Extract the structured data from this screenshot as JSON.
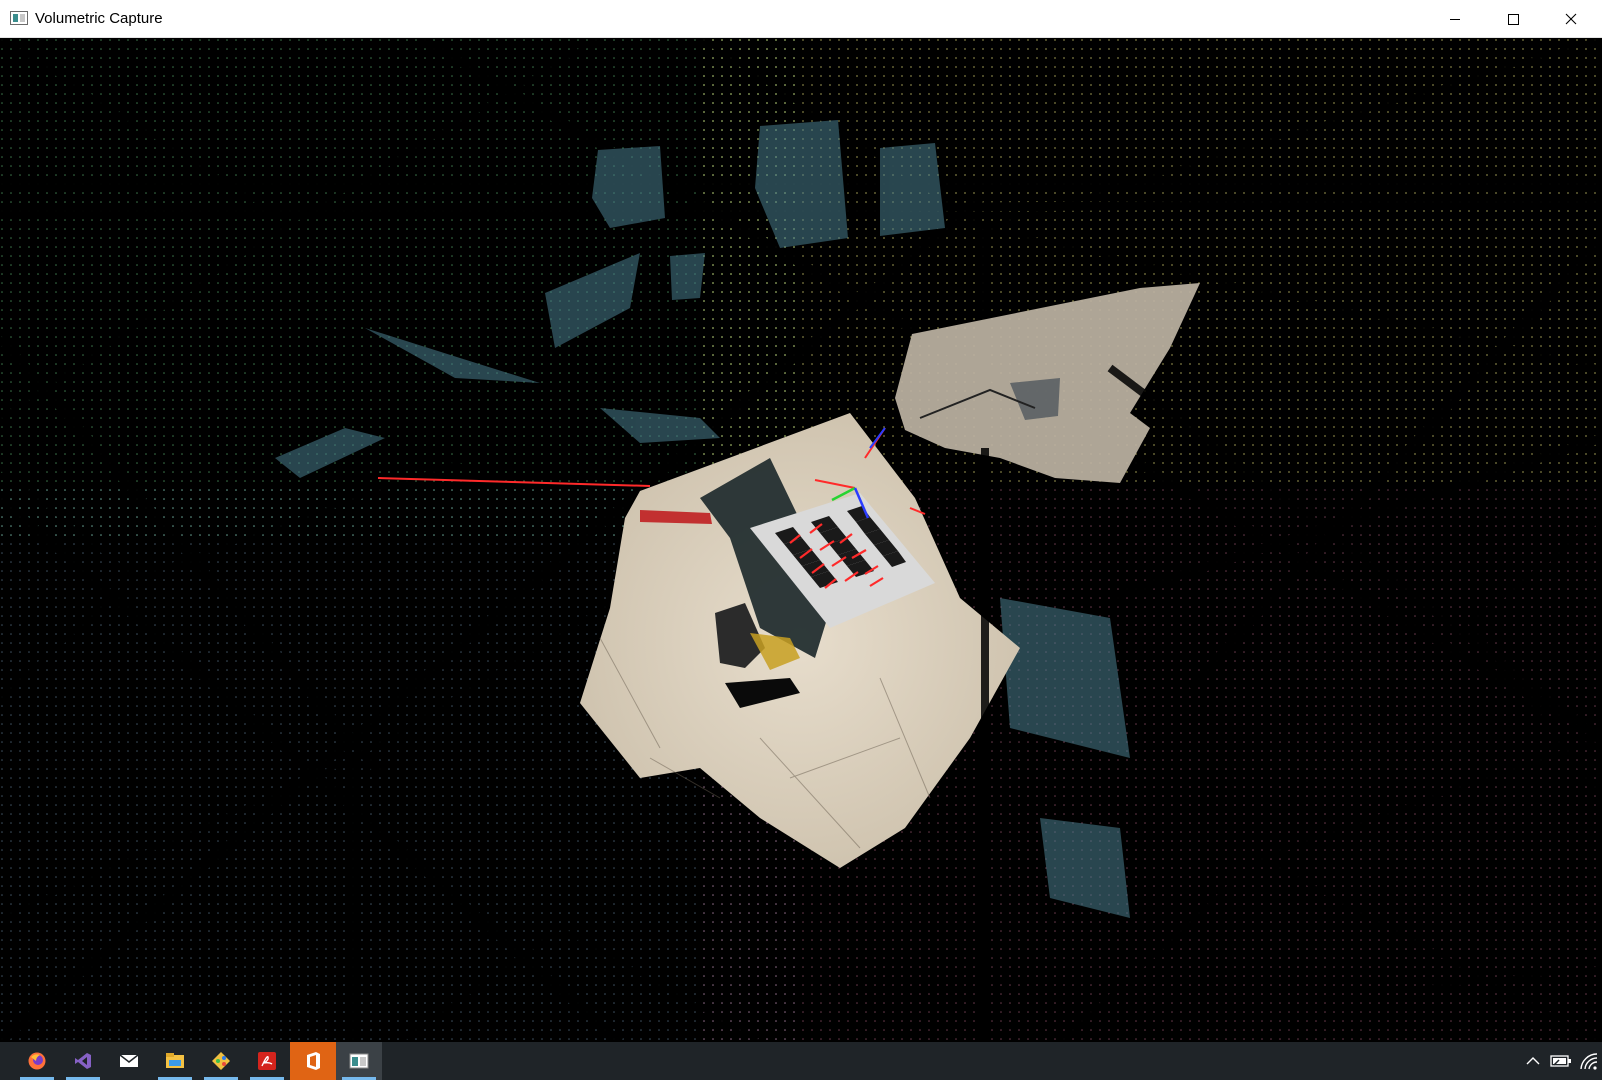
{
  "window": {
    "title": "Volumetric Capture",
    "icon": "app-window-icon",
    "controls": {
      "minimize": "minimize-icon",
      "maximize": "maximize-icon",
      "close": "close-icon"
    }
  },
  "viewport": {
    "content": "3d-point-cloud-view",
    "axis_colors": {
      "x": "#ff2a2a",
      "y": "#27d431",
      "z": "#2a3cff"
    },
    "background": "#000000"
  },
  "taskbar": {
    "apps": [
      {
        "icon": "firefox-icon",
        "color": "#ff7139",
        "running": true
      },
      {
        "icon": "visual-studio-icon",
        "color": "#8661c5",
        "running": true
      },
      {
        "icon": "mail-icon",
        "color": "#ffffff",
        "running": false
      },
      {
        "icon": "file-explorer-icon",
        "color": "#f5c243",
        "running": true
      },
      {
        "icon": "git-icon",
        "color": "#f0c040",
        "running": true
      },
      {
        "icon": "acrobat-icon",
        "color": "#d4241d",
        "running": true
      },
      {
        "icon": "office-icon",
        "color": "#ffffff",
        "running": true,
        "active": true
      },
      {
        "icon": "volumetric-capture-icon",
        "color": "#cfd8dc",
        "running": true,
        "focused": true
      }
    ],
    "tray": {
      "show-hidden": "chevron-up-icon",
      "battery": "battery-icon",
      "network": "wifi-icon"
    }
  }
}
